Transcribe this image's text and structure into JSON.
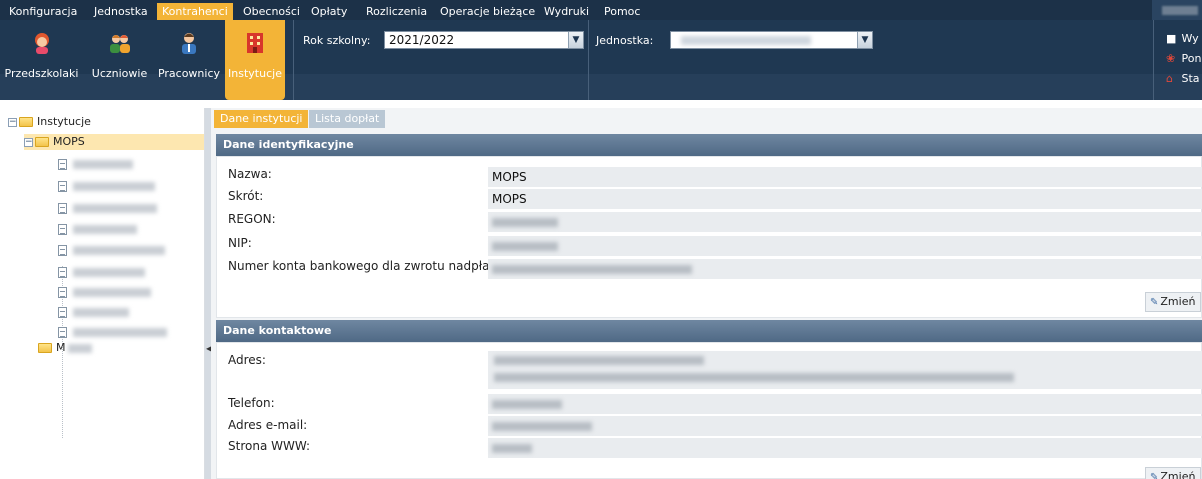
{
  "menu": {
    "items": [
      {
        "label": "Konfiguracja",
        "active": false
      },
      {
        "label": "Jednostka",
        "active": false
      },
      {
        "label": "Kontrahenci",
        "active": true
      },
      {
        "label": "Obecności",
        "active": false
      },
      {
        "label": "Opłaty",
        "active": false
      },
      {
        "label": "Rozliczenia",
        "active": false
      },
      {
        "label": "Operacje bieżące",
        "active": false
      },
      {
        "label": "Wydruki",
        "active": false
      },
      {
        "label": "Pomoc",
        "active": false
      }
    ]
  },
  "toolbar": {
    "buttons": [
      {
        "label": "Przedszkolaki",
        "icon": "child-icon"
      },
      {
        "label": "Uczniowie",
        "icon": "students-icon"
      },
      {
        "label": "Pracownicy",
        "icon": "employee-icon"
      },
      {
        "label": "Instytucje",
        "icon": "building-icon",
        "active": true
      }
    ],
    "school_year_label": "Rok szkolny:",
    "school_year_value": "2021/2022",
    "unit_label": "Jednostka:",
    "right_links": [
      {
        "label": "Wy",
        "icon": "lock-icon"
      },
      {
        "label": "Pon",
        "icon": "lifebuoy-icon"
      },
      {
        "label": "Sta",
        "icon": "home-icon"
      }
    ]
  },
  "tree": {
    "root_label": "Instytucje",
    "selected_label": "MOPS",
    "second_label": "M"
  },
  "tabs": [
    "Dane instytucji",
    "Lista dopłat"
  ],
  "identification": {
    "header": "Dane identyfikacyjne",
    "name_label": "Nazwa:",
    "name_value": "MOPS",
    "short_label": "Skrót:",
    "short_value": "MOPS",
    "regon_label": "REGON:",
    "nip_label": "NIP:",
    "account_label": "Numer konta bankowego dla zwrotu nadpłat:",
    "change_label": "Zmień"
  },
  "contact": {
    "header": "Dane kontaktowe",
    "address_label": "Adres:",
    "phone_label": "Telefon:",
    "email_label": "Adres e-mail:",
    "www_label": "Strona WWW:",
    "change_label": "Zmień"
  },
  "colors": {
    "accent": "#f3b437",
    "toolbar_bg": "#1f3852",
    "section_header": "#5a7390"
  }
}
